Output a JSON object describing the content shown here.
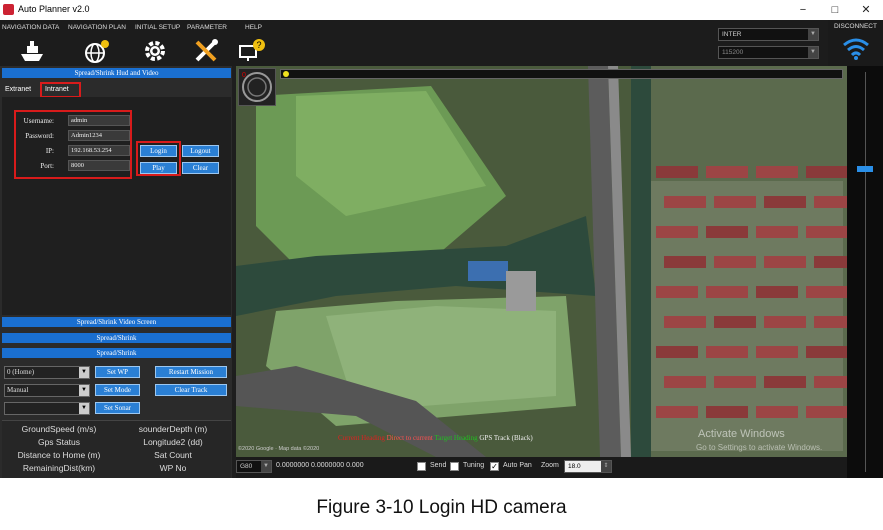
{
  "window": {
    "title": "Auto Planner v2.0",
    "minimize": "−",
    "restore": "□",
    "close": "✕"
  },
  "menu": {
    "navigation_data": "NAVIGATION DATA",
    "navigation_plan": "NAVIGATION PLAN",
    "initial_setup": "INITIAL SETUP",
    "parameter": "PARAMETER",
    "help": "HELP"
  },
  "connection": {
    "interface_value": "INTER",
    "baud_value": "115200",
    "disconnect_label": "DISCONNECT"
  },
  "left_panel": {
    "spread_video_label": "Spread/Shrink Hud and Video",
    "tabs": [
      "Extranet",
      "Intranet"
    ],
    "login": {
      "username_label": "Username:",
      "username_value": "admin",
      "password_label": "Password:",
      "password_value": "Admin1234",
      "ip_label": "IP:",
      "ip_value": "192.168.53.254",
      "port_label": "Port:",
      "port_value": "8000",
      "login_button": "Login",
      "logout_button": "Logout",
      "play_button": "Play",
      "clear_button": "Clear"
    },
    "spread_video_screen_label": "Spread/Shrink Video Screen",
    "spread_shrink_1": "Spread/Shrink",
    "spread_shrink_2": "Spread/Shrink",
    "mission": {
      "waypoint_value": "0 (Home)",
      "set_wp": "Set WP",
      "restart_mission": "Restart Mission",
      "mode_value": "Manual",
      "set_mode": "Set Mode",
      "clear_track": "Clear Track",
      "sonar_value": "",
      "set_sonar": "Set Sonar"
    },
    "stats": [
      "GroundSpeed (m/s)",
      "sounderDepth (m)",
      "Gps Status",
      "Longitude2 (dd)",
      "Distance to Home (m)",
      "Sat Count",
      "RemainingDist(km)",
      "WP No"
    ]
  },
  "map": {
    "legend_current_heading": "Current Heading",
    "legend_direct": "Direct to current",
    "legend_target": "Target Heading",
    "legend_gps": "GPS Track (Black)",
    "attribution": "©2020 Google · Map data ©2020",
    "activate_line1": "Activate Windows",
    "activate_line2": "Go to Settings to activate Windows."
  },
  "bottom_bar": {
    "coord_system": "G80",
    "coords": "0.0000000  0.0000000  0.000",
    "send": "Send",
    "tuning": "Tuning",
    "auto_pan": "Auto Pan",
    "zoom_label": "Zoom",
    "zoom_value": "18.0"
  },
  "caption": "Figure 3-10 Login HD camera",
  "colors": {
    "accent_blue": "#2a7fd4",
    "highlight_red": "#d81b1b"
  }
}
